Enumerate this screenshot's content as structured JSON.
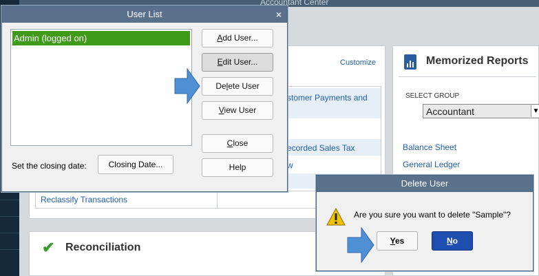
{
  "background": {
    "window_title": "Accountant Center",
    "tasks": {
      "customize_link": "Customize",
      "customer_payments_fragment": "stomer Payments and",
      "sales_tax_fragment": "ecorded Sales Tax",
      "view_fragment": "w",
      "reclassify_link": "Reclassify Transactions"
    },
    "memorized_reports": {
      "title": "Memorized Reports",
      "select_group_label": "SELECT GROUP",
      "selected_group": "Accountant",
      "links": [
        "Balance Sheet",
        "General Ledger"
      ]
    },
    "reconciliation": {
      "title": "Reconciliation"
    }
  },
  "user_list_dialog": {
    "title": "User List",
    "close_glyph": "×",
    "users": [
      "Admin (logged on)"
    ],
    "buttons": {
      "add_user_prefix": "A",
      "add_user_rest": "dd User...",
      "edit_user_prefix": "E",
      "edit_user_rest": "dit User...",
      "delete_user_pre": "De",
      "delete_user_u": "l",
      "delete_user_post": "ete User",
      "view_user_prefix": "V",
      "view_user_rest": "iew User",
      "close_prefix": "C",
      "close_rest": "lose",
      "help": "Help"
    },
    "closing_date_label": "Set the closing date:",
    "closing_date_button": "Closing Date..."
  },
  "delete_user_dialog": {
    "title": "Delete User",
    "message": "Are you sure you want to delete \"Sample\"?",
    "yes_prefix": "Y",
    "yes_rest": "es",
    "no_prefix": "N",
    "no_rest": "o"
  },
  "colors": {
    "dialog_title_bar": "#59718a",
    "selected_row": "#3f9a1a",
    "no_button": "#1e4fb0",
    "pointer_arrow": "#4f8fd4",
    "link": "#1f5ea8"
  }
}
